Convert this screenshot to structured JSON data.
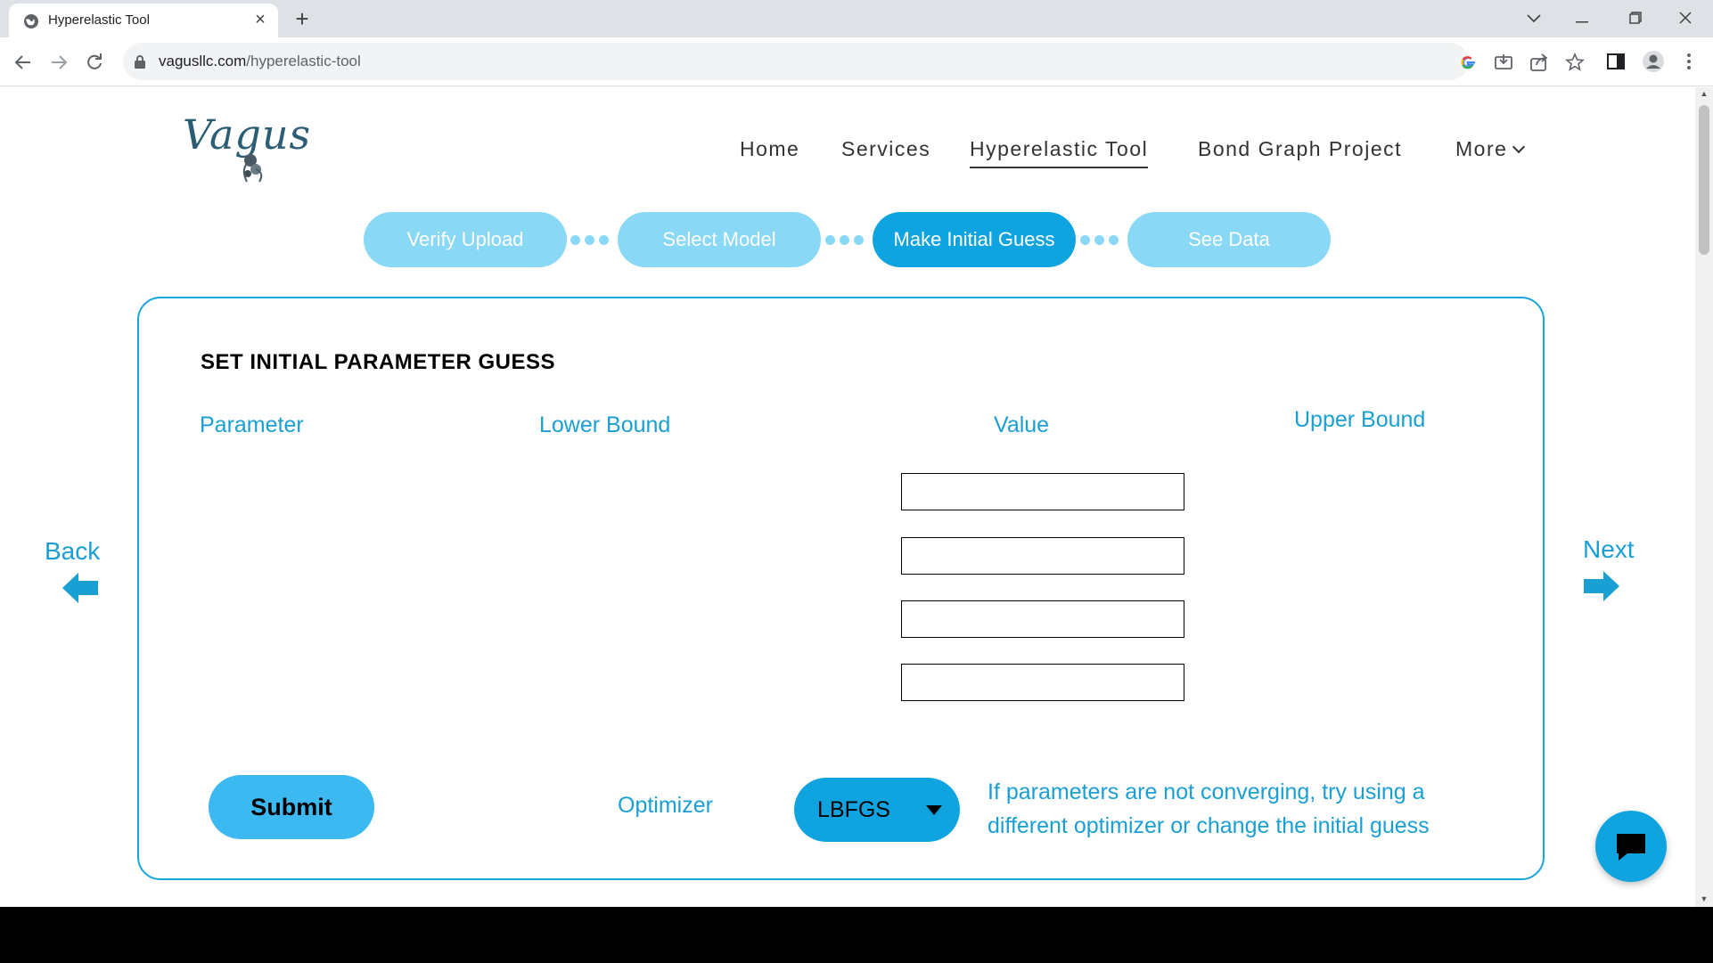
{
  "browser": {
    "tab_title": "Hyperelastic Tool",
    "url_domain": "vagusllc.com",
    "url_path": "/hyperelastic-tool",
    "window_controls": [
      "chevron-down-icon",
      "minimize-icon",
      "restore-icon",
      "close-icon"
    ]
  },
  "site": {
    "logo_text": "Vagus",
    "nav": [
      "Home",
      "Services",
      "Hyperelastic Tool",
      "Bond Graph Project",
      "More"
    ],
    "active_nav": "Hyperelastic Tool"
  },
  "steps": [
    "Verify Upload",
    "Select Model",
    "Make Initial Guess",
    "See Data"
  ],
  "active_step": "Make Initial Guess",
  "form": {
    "title": "SET INITIAL PARAMETER GUESS",
    "columns": {
      "parameter": "Parameter",
      "lower_bound": "Lower Bound",
      "value": "Value",
      "upper_bound": "Upper Bound"
    },
    "value_inputs": [
      "",
      "",
      "",
      ""
    ],
    "submit_label": "Submit",
    "optimizer_label": "Optimizer",
    "optimizer_value": "LBFGS",
    "hint": "If parameters are not converging,  try using a different optimizer or change the initial guess"
  },
  "navigation": {
    "back_label": "Back",
    "next_label": "Next"
  },
  "colors": {
    "accent": "#0fa4e0",
    "accent_light": "#89d8f5",
    "text_link": "#1a9fd4"
  }
}
